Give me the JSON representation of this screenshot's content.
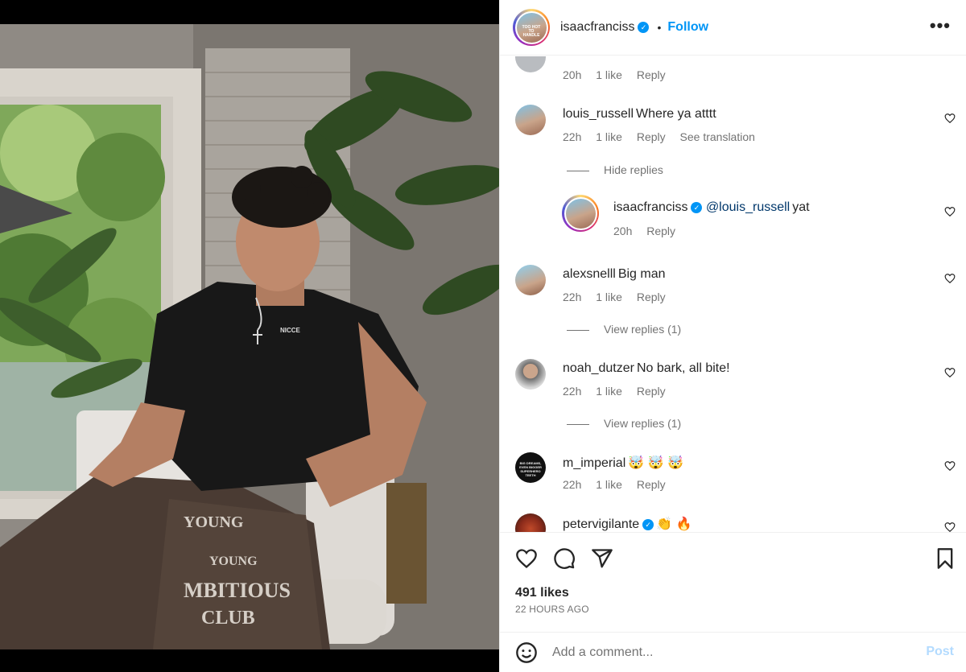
{
  "post": {
    "author": "isaacfranciss",
    "author_verified": true,
    "follow_label": "Follow",
    "separator": "•",
    "more_label": "•••",
    "avatar_caption": "TOO HOT TO HANDLE"
  },
  "photo": {
    "shirt_text": "NICCE",
    "pants_line1": "YOUNG",
    "pants_line2": "MBITIOUS",
    "pants_line3": "CLUB",
    "pants_top": "YOUNG"
  },
  "comments": [
    {
      "id": "partial",
      "user": "",
      "text": "",
      "time": "20h",
      "likes": "1 like",
      "reply": "Reply",
      "translation": ""
    },
    {
      "id": "louis",
      "user": "louis_russell",
      "text": "Where ya atttt",
      "time": "22h",
      "likes": "1 like",
      "reply": "Reply",
      "translation": "See translation",
      "replies_toggle": "Hide replies"
    },
    {
      "id": "isaac-reply",
      "user": "isaacfranciss",
      "mention": "@louis_russell",
      "text": "yat",
      "time": "20h",
      "reply": "Reply"
    },
    {
      "id": "alex",
      "user": "alexsnelll",
      "text": "Big man",
      "time": "22h",
      "likes": "1 like",
      "reply": "Reply",
      "replies_toggle": "View replies (1)"
    },
    {
      "id": "noah",
      "user": "noah_dutzer",
      "text": "No bark, all bite!",
      "time": "22h",
      "likes": "1 like",
      "reply": "Reply",
      "replies_toggle": "View replies (1)"
    },
    {
      "id": "imperial",
      "user": "m_imperial",
      "text": "🤯 🤯 🤯",
      "time": "22h",
      "likes": "1 like",
      "reply": "Reply",
      "avatar_text": "BIG DREAMS, EVEN BIGGER SUPERHERO TEETH"
    },
    {
      "id": "peter",
      "user": "petervigilante",
      "text": "👏 🔥"
    }
  ],
  "actions": {
    "likes": "491 likes",
    "time_ago": "22 HOURS AGO"
  },
  "composer": {
    "placeholder": "Add a comment...",
    "post_label": "Post"
  },
  "colors": {
    "accent": "#0095f6",
    "text": "#262626",
    "muted": "#737373",
    "post_disabled": "#b3dbff"
  }
}
